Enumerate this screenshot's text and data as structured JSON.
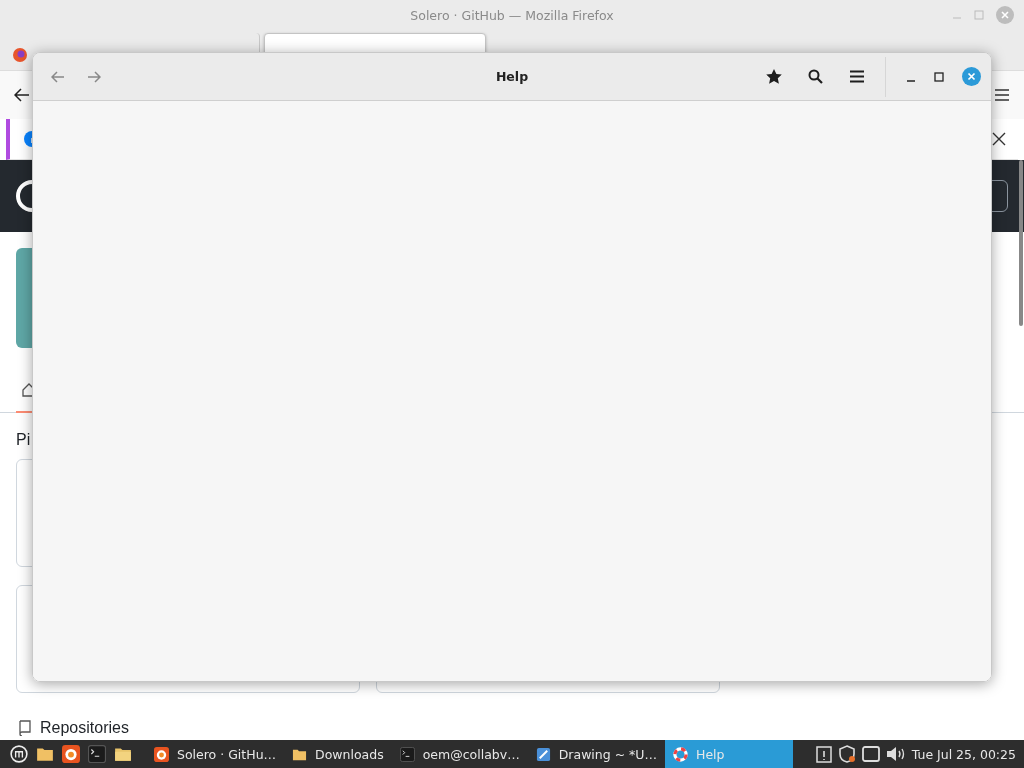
{
  "browser_window": {
    "title": "Solero · GitHub — Mozilla Firefox",
    "tabs": [
      {
        "selected": false
      },
      {
        "selected": true
      }
    ],
    "section_heading": "Pi",
    "repositories_heading": "Repositories"
  },
  "help_window": {
    "title": "Help"
  },
  "taskbar": {
    "launchers": [
      {
        "kind": "menu"
      },
      {
        "kind": "folder"
      },
      {
        "kind": "firefox"
      },
      {
        "kind": "terminal"
      },
      {
        "kind": "files"
      }
    ],
    "tasks": [
      {
        "kind": "firefox",
        "label": "Solero · GitHu…",
        "selected": false
      },
      {
        "kind": "folder",
        "label": "Downloads",
        "selected": false
      },
      {
        "kind": "terminal",
        "label": "oem@collabv…",
        "selected": false
      },
      {
        "kind": "drawing",
        "label": "Drawing ~ *U…",
        "selected": false
      },
      {
        "kind": "help",
        "label": "Help",
        "selected": true
      }
    ],
    "clock": "Tue Jul 25, 00:25"
  }
}
